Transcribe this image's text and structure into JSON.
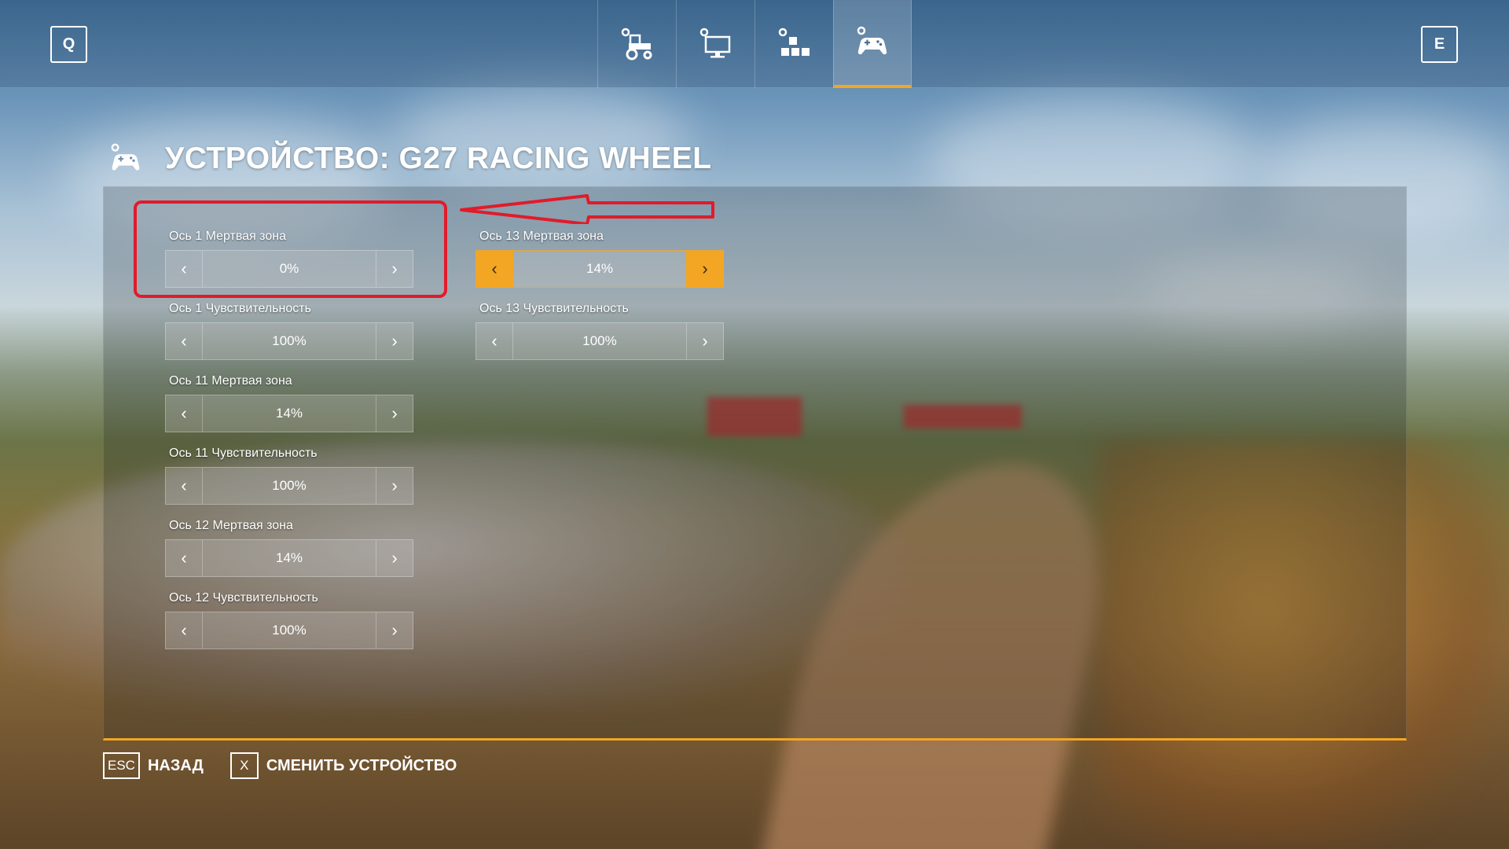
{
  "topbar": {
    "left_key": "Q",
    "right_key": "E",
    "tabs": [
      {
        "icon": "gear-tractor-icon",
        "active": false
      },
      {
        "icon": "gear-monitor-icon",
        "active": false
      },
      {
        "icon": "gear-blocks-icon",
        "active": false
      },
      {
        "icon": "gear-gamepad-icon",
        "active": true
      }
    ]
  },
  "header": {
    "icon": "gear-gamepad-icon",
    "title": "УСТРОЙСТВО: G27 RACING WHEEL"
  },
  "settings": {
    "left": [
      {
        "label": "Ось 1 Мертвая зона",
        "value": "0%"
      },
      {
        "label": "Ось 1 Чувствительность",
        "value": "100%"
      },
      {
        "label": "Ось 11 Мертвая зона",
        "value": "14%"
      },
      {
        "label": "Ось 11 Чувствительность",
        "value": "100%"
      },
      {
        "label": "Ось 12 Мертвая зона",
        "value": "14%"
      },
      {
        "label": "Ось 12 Чувствительность",
        "value": "100%"
      }
    ],
    "right": [
      {
        "label": "Ось 13 Мертвая зона",
        "value": "14%",
        "focused": true
      },
      {
        "label": "Ось 13 Чувствительность",
        "value": "100%"
      }
    ]
  },
  "footer": {
    "back_key": "ESC",
    "back_label": "НАЗАД",
    "switch_key": "X",
    "switch_label": "СМЕНИТЬ УСТРОЙСТВО"
  },
  "colors": {
    "accent": "#f2a623",
    "annotation": "#e11b2a"
  }
}
